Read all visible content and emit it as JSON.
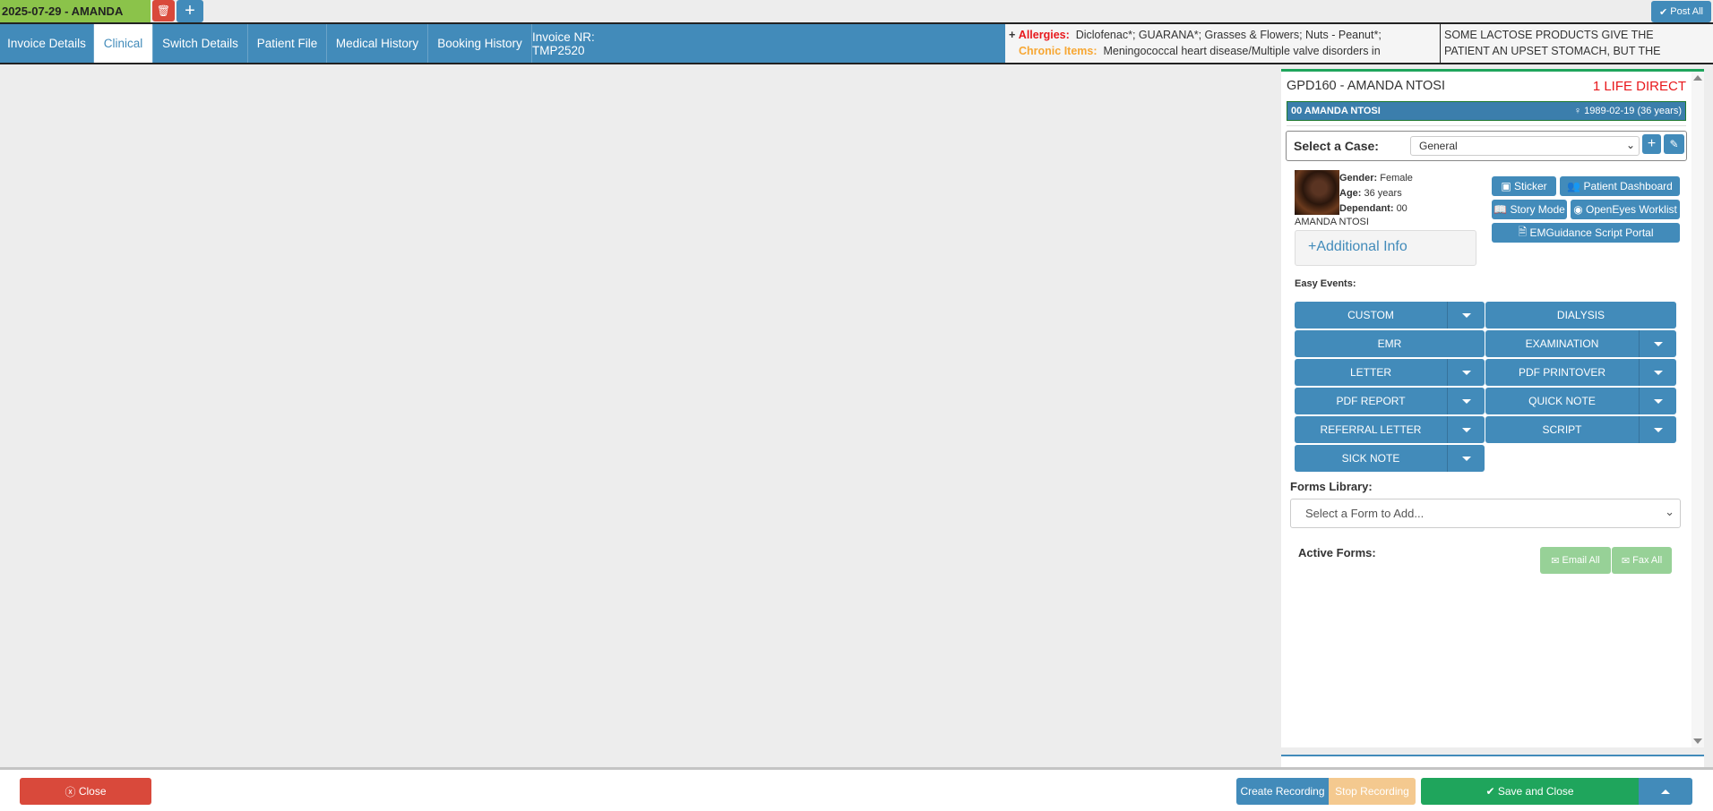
{
  "top": {
    "session_tab": "2025-07-29 - AMANDA",
    "post_all": "Post All"
  },
  "nav": {
    "tabs": [
      "Invoice Details",
      "Clinical",
      "Switch Details",
      "Patient File",
      "Medical History",
      "Booking History",
      "Invoice NR: TMP2520"
    ],
    "active": "Clinical"
  },
  "alerts": {
    "expand": "+",
    "allergies_label": "Allergies:",
    "allergies": "Diclofenac*; GUARANA*; Grasses & Flowers; Nuts - Peanut*;",
    "chronic_label": "Chronic Items:",
    "chronic": "Meningococcal heart disease/Multiple valve disorders in",
    "note_line1": "SOME LACTOSE PRODUCTS GIVE THE",
    "note_line2": "PATIENT AN UPSET STOMACH, BUT THE"
  },
  "patient": {
    "title": "GPD160 - AMANDA NTOSI",
    "scheme": "1 LIFE DIRECT",
    "bar_name": "00 AMANDA NTOSI",
    "dob": "1989-02-19 (36 years)",
    "case_label": "Select a Case:",
    "case_value": "General",
    "gender_label": "Gender:",
    "gender": "Female",
    "age_label": "Age:",
    "age": "36 years",
    "dep_label": "Dependant:",
    "dep": "00",
    "name": "AMANDA NTOSI",
    "additional_info": "Additional Info"
  },
  "actions": {
    "sticker": "Sticker",
    "dashboard": "Patient Dashboard",
    "story": "Story Mode",
    "openeyes": "OpenEyes Worklist",
    "emguidance": "EMGuidance Script Portal"
  },
  "easy_events": {
    "label": "Easy Events:",
    "items": [
      {
        "label": "CUSTOM",
        "dropdown": true
      },
      {
        "label": "DIALYSIS",
        "dropdown": false
      },
      {
        "label": "EMR",
        "dropdown": false
      },
      {
        "label": "EXAMINATION",
        "dropdown": true
      },
      {
        "label": "LETTER",
        "dropdown": true
      },
      {
        "label": "PDF PRINTOVER",
        "dropdown": true
      },
      {
        "label": "PDF REPORT",
        "dropdown": true
      },
      {
        "label": "QUICK NOTE",
        "dropdown": true
      },
      {
        "label": "REFERRAL LETTER",
        "dropdown": true
      },
      {
        "label": "SCRIPT",
        "dropdown": true
      },
      {
        "label": "SICK NOTE",
        "dropdown": true
      }
    ]
  },
  "forms": {
    "label": "Forms Library:",
    "placeholder": "Select a Form to Add...",
    "active_label": "Active Forms:",
    "email_all": "Email All",
    "fax_all": "Fax All"
  },
  "footer": {
    "close": "Close",
    "create_recording": "Create Recording",
    "stop_recording": "Stop Recording",
    "save_close": "Save and Close"
  },
  "colors": {
    "primary": "#428bba",
    "success": "#1fa55c",
    "danger": "#d9493b",
    "warning": "#f4c98f"
  }
}
